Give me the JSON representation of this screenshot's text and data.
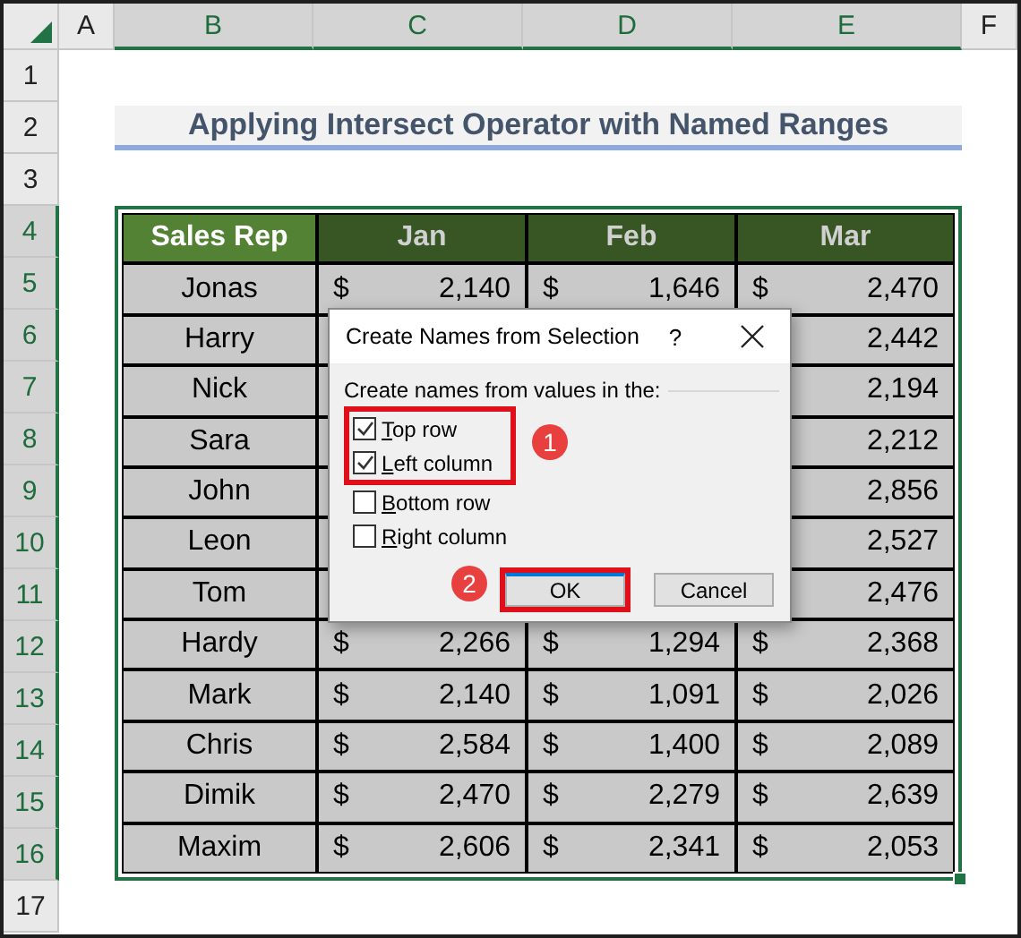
{
  "sheet": {
    "columns": [
      {
        "label": "A",
        "selected": false
      },
      {
        "label": "B",
        "selected": true
      },
      {
        "label": "C",
        "selected": true
      },
      {
        "label": "D",
        "selected": true
      },
      {
        "label": "E",
        "selected": true
      },
      {
        "label": "F",
        "selected": false
      }
    ],
    "rows": [
      {
        "label": "1",
        "selected": false
      },
      {
        "label": "2",
        "selected": false
      },
      {
        "label": "3",
        "selected": false
      },
      {
        "label": "4",
        "selected": true
      },
      {
        "label": "5",
        "selected": true
      },
      {
        "label": "6",
        "selected": true
      },
      {
        "label": "7",
        "selected": true
      },
      {
        "label": "8",
        "selected": true
      },
      {
        "label": "9",
        "selected": true
      },
      {
        "label": "10",
        "selected": true
      },
      {
        "label": "11",
        "selected": true
      },
      {
        "label": "12",
        "selected": true
      },
      {
        "label": "13",
        "selected": true
      },
      {
        "label": "14",
        "selected": true
      },
      {
        "label": "15",
        "selected": true
      },
      {
        "label": "16",
        "selected": true
      },
      {
        "label": "17",
        "selected": false
      }
    ]
  },
  "title": "Applying Intersect Operator with Named Ranges",
  "table": {
    "headers": [
      {
        "label": "Sales Rep",
        "kind": "key"
      },
      {
        "label": "Jan",
        "kind": "month"
      },
      {
        "label": "Feb",
        "kind": "month"
      },
      {
        "label": "Mar",
        "kind": "month"
      }
    ],
    "rows": [
      {
        "rep": "Jonas",
        "jan": {
          "symbol": "$",
          "amount": "2,140"
        },
        "feb": {
          "symbol": "$",
          "amount": "1,646"
        },
        "mar": {
          "symbol": "$",
          "amount": "2,470"
        }
      },
      {
        "rep": "Harry",
        "mar": {
          "amount": "2,442"
        }
      },
      {
        "rep": "Nick",
        "mar": {
          "amount": "2,194"
        }
      },
      {
        "rep": "Sara",
        "mar": {
          "amount": "2,212"
        }
      },
      {
        "rep": "John",
        "mar": {
          "amount": "2,856"
        }
      },
      {
        "rep": "Leon",
        "mar": {
          "amount": "2,527"
        }
      },
      {
        "rep": "Tom",
        "mar": {
          "amount": "2,476"
        }
      },
      {
        "rep": "Hardy",
        "jan": {
          "symbol": "$",
          "amount": "2,266"
        },
        "feb": {
          "symbol": "$",
          "amount": "1,294"
        },
        "mar": {
          "symbol": "$",
          "amount": "2,368"
        }
      },
      {
        "rep": "Mark",
        "jan": {
          "symbol": "$",
          "amount": "2,140"
        },
        "feb": {
          "symbol": "$",
          "amount": "1,091"
        },
        "mar": {
          "symbol": "$",
          "amount": "2,026"
        }
      },
      {
        "rep": "Chris",
        "jan": {
          "symbol": "$",
          "amount": "2,584"
        },
        "feb": {
          "symbol": "$",
          "amount": "1,400"
        },
        "mar": {
          "symbol": "$",
          "amount": "2,089"
        }
      },
      {
        "rep": "Dimik",
        "jan": {
          "symbol": "$",
          "amount": "2,470"
        },
        "feb": {
          "symbol": "$",
          "amount": "2,279"
        },
        "mar": {
          "symbol": "$",
          "amount": "2,639"
        }
      },
      {
        "rep": "Maxim",
        "jan": {
          "symbol": "$",
          "amount": "2,606"
        },
        "feb": {
          "symbol": "$",
          "amount": "2,341"
        },
        "mar": {
          "symbol": "$",
          "amount": "2,053"
        }
      }
    ]
  },
  "dialog": {
    "title": "Create Names from Selection",
    "help": "?",
    "group_label": "Create names from values in the:",
    "options": [
      {
        "label": "Top row",
        "checked": true,
        "highlighted": true
      },
      {
        "label": "Left column",
        "checked": true,
        "highlighted": true
      },
      {
        "label": "Bottom row",
        "checked": false,
        "highlighted": false
      },
      {
        "label": "Right column",
        "checked": false,
        "highlighted": false
      }
    ],
    "buttons": [
      {
        "label": "OK",
        "kind": "default",
        "highlighted": true
      },
      {
        "label": "Cancel",
        "kind": "normal",
        "highlighted": false
      }
    ],
    "callouts": [
      {
        "label": "1"
      },
      {
        "label": "2"
      }
    ]
  }
}
